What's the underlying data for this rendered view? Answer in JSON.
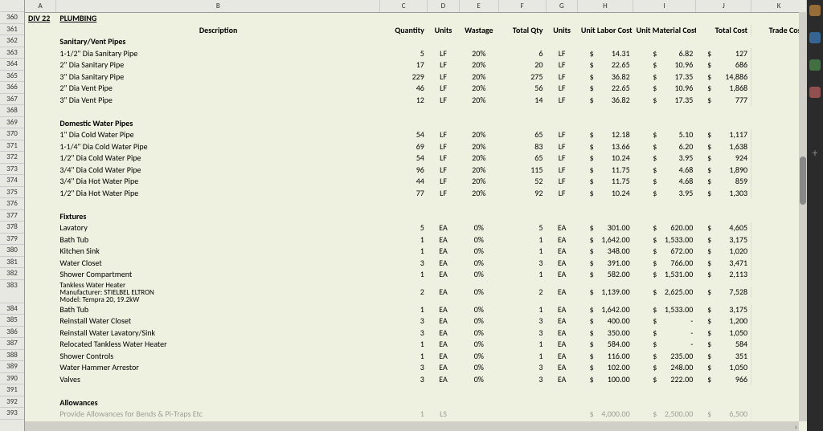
{
  "cols": [
    "A",
    "B",
    "C",
    "D",
    "E",
    "F",
    "G",
    "H",
    "I",
    "J",
    "K"
  ],
  "rownums_start": 360,
  "rownums_end": 393,
  "div": "DIV 22",
  "subtitle": "PLUMBING",
  "headers": {
    "desc": "Description",
    "qty": "Quantity",
    "units": "Units",
    "wast": "Wastage",
    "tqty": "Total Qty",
    "units2": "Units",
    "ulc": "Unit Labor Cost",
    "umc": "Unit Material Cost",
    "tc": "Total Cost",
    "trc": "Trade Cost"
  },
  "sections": [
    {
      "title": "Sanitary/Vent Pipes",
      "rows": [
        {
          "b": "1-1/2\" Dia Sanitary Pipe",
          "c": "5",
          "d": "LF",
          "e": "20%",
          "f": "6",
          "g": "LF",
          "h": "14.31",
          "i": "6.82",
          "j": "127"
        },
        {
          "b": "2\" Dia Sanitary Pipe",
          "c": "17",
          "d": "LF",
          "e": "20%",
          "f": "20",
          "g": "LF",
          "h": "22.65",
          "i": "10.96",
          "j": "686"
        },
        {
          "b": "3\" Dia Sanitary Pipe",
          "c": "229",
          "d": "LF",
          "e": "20%",
          "f": "275",
          "g": "LF",
          "h": "36.82",
          "i": "17.35",
          "j": "14,886"
        },
        {
          "b": "2\" Dia Vent Pipe",
          "c": "46",
          "d": "LF",
          "e": "20%",
          "f": "56",
          "g": "LF",
          "h": "22.65",
          "i": "10.96",
          "j": "1,868"
        },
        {
          "b": "3\" Dia Vent Pipe",
          "c": "12",
          "d": "LF",
          "e": "20%",
          "f": "14",
          "g": "LF",
          "h": "36.82",
          "i": "17.35",
          "j": "777"
        }
      ]
    },
    {
      "title": "Domestic Water Pipes",
      "rows": [
        {
          "b": "1\" Dia Cold Water Pipe",
          "c": "54",
          "d": "LF",
          "e": "20%",
          "f": "65",
          "g": "LF",
          "h": "12.18",
          "i": "5.10",
          "j": "1,117"
        },
        {
          "b": "1-1/4\" Dia Cold Water Pipe",
          "c": "69",
          "d": "LF",
          "e": "20%",
          "f": "83",
          "g": "LF",
          "h": "13.66",
          "i": "6.20",
          "j": "1,638"
        },
        {
          "b": "1/2\" Dia Cold Water Pipe",
          "c": "54",
          "d": "LF",
          "e": "20%",
          "f": "65",
          "g": "LF",
          "h": "10.24",
          "i": "3.95",
          "j": "924"
        },
        {
          "b": "3/4\" Dia Cold Water Pipe",
          "c": "96",
          "d": "LF",
          "e": "20%",
          "f": "115",
          "g": "LF",
          "h": "11.75",
          "i": "4.68",
          "j": "1,890"
        },
        {
          "b": "3/4\" Dia Hot Water Pipe",
          "c": "44",
          "d": "LF",
          "e": "20%",
          "f": "52",
          "g": "LF",
          "h": "11.75",
          "i": "4.68",
          "j": "859"
        },
        {
          "b": "1/2\" Dia Hot Water Pipe",
          "c": "77",
          "d": "LF",
          "e": "20%",
          "f": "92",
          "g": "LF",
          "h": "10.24",
          "i": "3.95",
          "j": "1,303"
        }
      ]
    },
    {
      "title": "Fixtures",
      "rows": [
        {
          "b": "Lavatory",
          "c": "5",
          "d": "EA",
          "e": "0%",
          "f": "5",
          "g": "EA",
          "h": "301.00",
          "i": "620.00",
          "j": "4,605"
        },
        {
          "b": "Bath Tub",
          "c": "1",
          "d": "EA",
          "e": "0%",
          "f": "1",
          "g": "EA",
          "h": "1,642.00",
          "i": "1,533.00",
          "j": "3,175"
        },
        {
          "b": "Kitchen Sink",
          "c": "1",
          "d": "EA",
          "e": "0%",
          "f": "1",
          "g": "EA",
          "h": "348.00",
          "i": "672.00",
          "j": "1,020"
        },
        {
          "b": "Water Closet",
          "c": "3",
          "d": "EA",
          "e": "0%",
          "f": "3",
          "g": "EA",
          "h": "391.00",
          "i": "766.00",
          "j": "3,471"
        },
        {
          "b": "Shower Compartment",
          "c": "1",
          "d": "EA",
          "e": "0%",
          "f": "1",
          "g": "EA",
          "h": "582.00",
          "i": "1,531.00",
          "j": "2,113"
        },
        {
          "tall": true,
          "b": "Tankless Water Heater\nManufacturer: STIELBEL ELTRON\nModel: Tempra 20, 19.2kW",
          "c": "2",
          "d": "EA",
          "e": "0%",
          "f": "2",
          "g": "EA",
          "h": "1,139.00",
          "i": "2,625.00",
          "j": "7,528"
        },
        {
          "b": "Bath Tub",
          "c": "1",
          "d": "EA",
          "e": "0%",
          "f": "1",
          "g": "EA",
          "h": "1,642.00",
          "i": "1,533.00",
          "j": "3,175"
        },
        {
          "b": "Reinstall Water Closet",
          "c": "3",
          "d": "EA",
          "e": "0%",
          "f": "3",
          "g": "EA",
          "h": "400.00",
          "i": "-",
          "j": "1,200"
        },
        {
          "b": "Reinstall Water Lavatory/Sink",
          "c": "3",
          "d": "EA",
          "e": "0%",
          "f": "3",
          "g": "EA",
          "h": "350.00",
          "i": "-",
          "j": "1,050"
        },
        {
          "b": "Relocated Tankless Water Heater",
          "c": "1",
          "d": "EA",
          "e": "0%",
          "f": "1",
          "g": "EA",
          "h": "584.00",
          "i": "-",
          "j": "584"
        },
        {
          "b": "Shower Controls",
          "c": "1",
          "d": "EA",
          "e": "0%",
          "f": "1",
          "g": "EA",
          "h": "116.00",
          "i": "235.00",
          "j": "351"
        },
        {
          "b": "Water Hammer Arrestor",
          "c": "3",
          "d": "EA",
          "e": "0%",
          "f": "3",
          "g": "EA",
          "h": "102.00",
          "i": "248.00",
          "j": "1,050"
        },
        {
          "b": "Valves",
          "c": "3",
          "d": "EA",
          "e": "0%",
          "f": "3",
          "g": "EA",
          "h": "100.00",
          "i": "222.00",
          "j": "966"
        }
      ]
    },
    {
      "title": "Allowances",
      "rows": [
        {
          "b": "Provide Allowances for Bends & Pi-Traps Etc",
          "c": "1",
          "d": "LS",
          "e": "",
          "f": "",
          "g": "",
          "h": "4,000.00",
          "i": "2,500.00",
          "j": "6,500",
          "faint": true
        }
      ]
    }
  ]
}
